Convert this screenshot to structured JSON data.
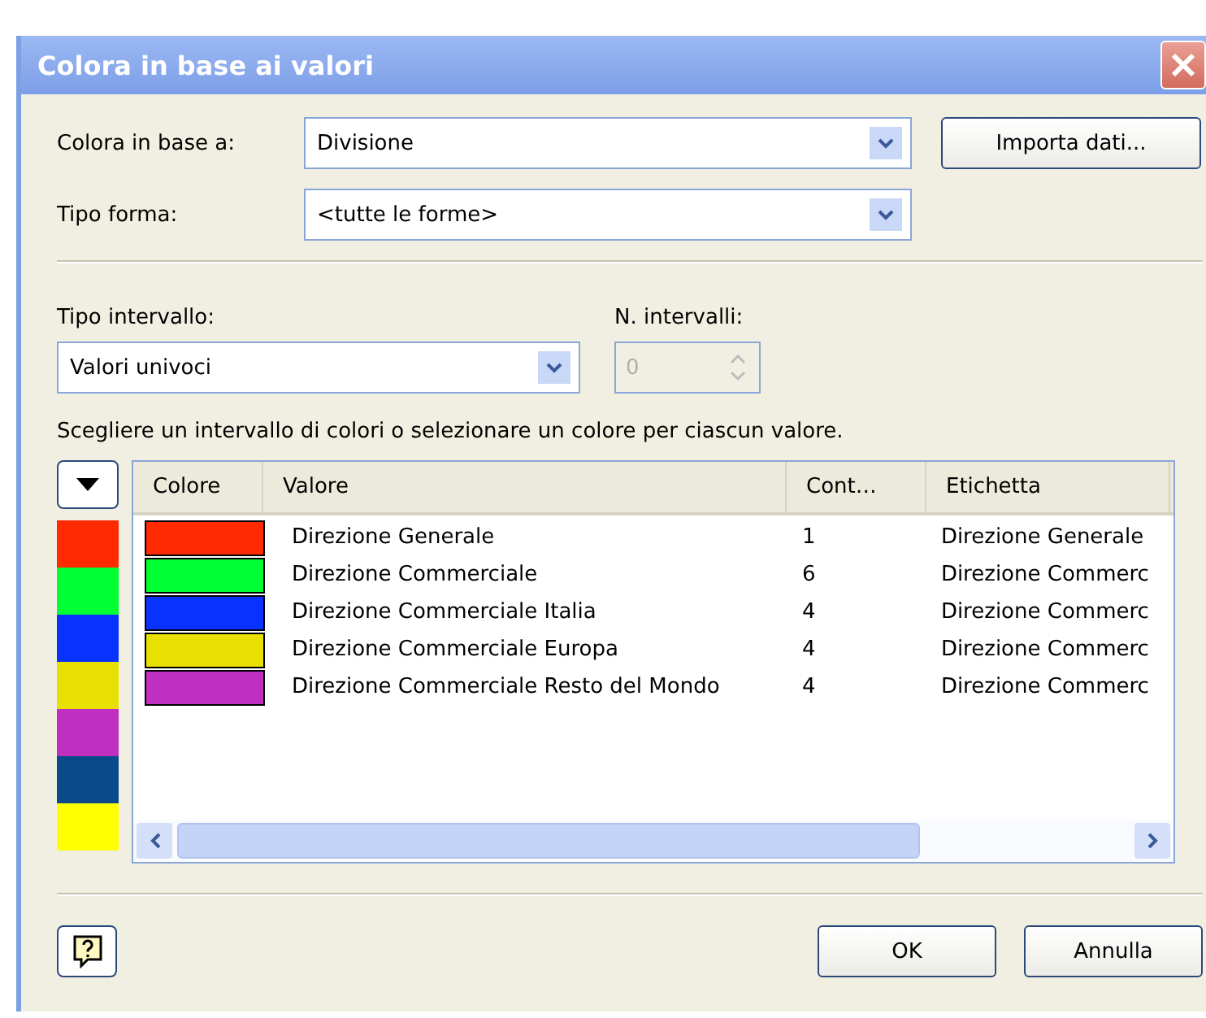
{
  "window": {
    "title": "Colora in base ai valori"
  },
  "color_by": {
    "label": "Colora in base a:",
    "value": "Divisione"
  },
  "import_button": "Importa dati...",
  "shape_type": {
    "label": "Tipo forma:",
    "value": "<tutte le forme>"
  },
  "interval_type": {
    "label": "Tipo intervallo:",
    "value": "Valori univoci"
  },
  "interval_count": {
    "label": "N. intervalli:",
    "value": "0",
    "disabled": true
  },
  "instruction": "Scegliere un intervallo di colori o selezionare un colore per ciascun valore.",
  "palette": [
    {
      "color": "#ff2a00"
    },
    {
      "color": "#00ff33"
    },
    {
      "color": "#0a32ff"
    },
    {
      "color": "#e8e000"
    },
    {
      "color": "#c030c0"
    },
    {
      "color": "#0a4a8a"
    },
    {
      "color": "#ffff00"
    }
  ],
  "table": {
    "columns": [
      "Colore",
      "Valore",
      "Cont…",
      "Etichetta"
    ],
    "rows": [
      {
        "color": "#ff2a00",
        "value": "Direzione Generale",
        "count": "1",
        "label": "Direzione Generale"
      },
      {
        "color": "#00ff33",
        "value": "Direzione Commerciale",
        "count": "6",
        "label": "Direzione Commerc"
      },
      {
        "color": "#0a32ff",
        "value": "Direzione Commerciale Italia",
        "count": "4",
        "label": "Direzione Commerc"
      },
      {
        "color": "#e8e000",
        "value": "Direzione Commerciale Europa",
        "count": "4",
        "label": "Direzione Commerc"
      },
      {
        "color": "#c030c0",
        "value": "Direzione Commerciale Resto del Mondo",
        "count": "4",
        "label": "Direzione Commerc"
      }
    ]
  },
  "buttons": [
    "OK",
    "Annulla"
  ]
}
